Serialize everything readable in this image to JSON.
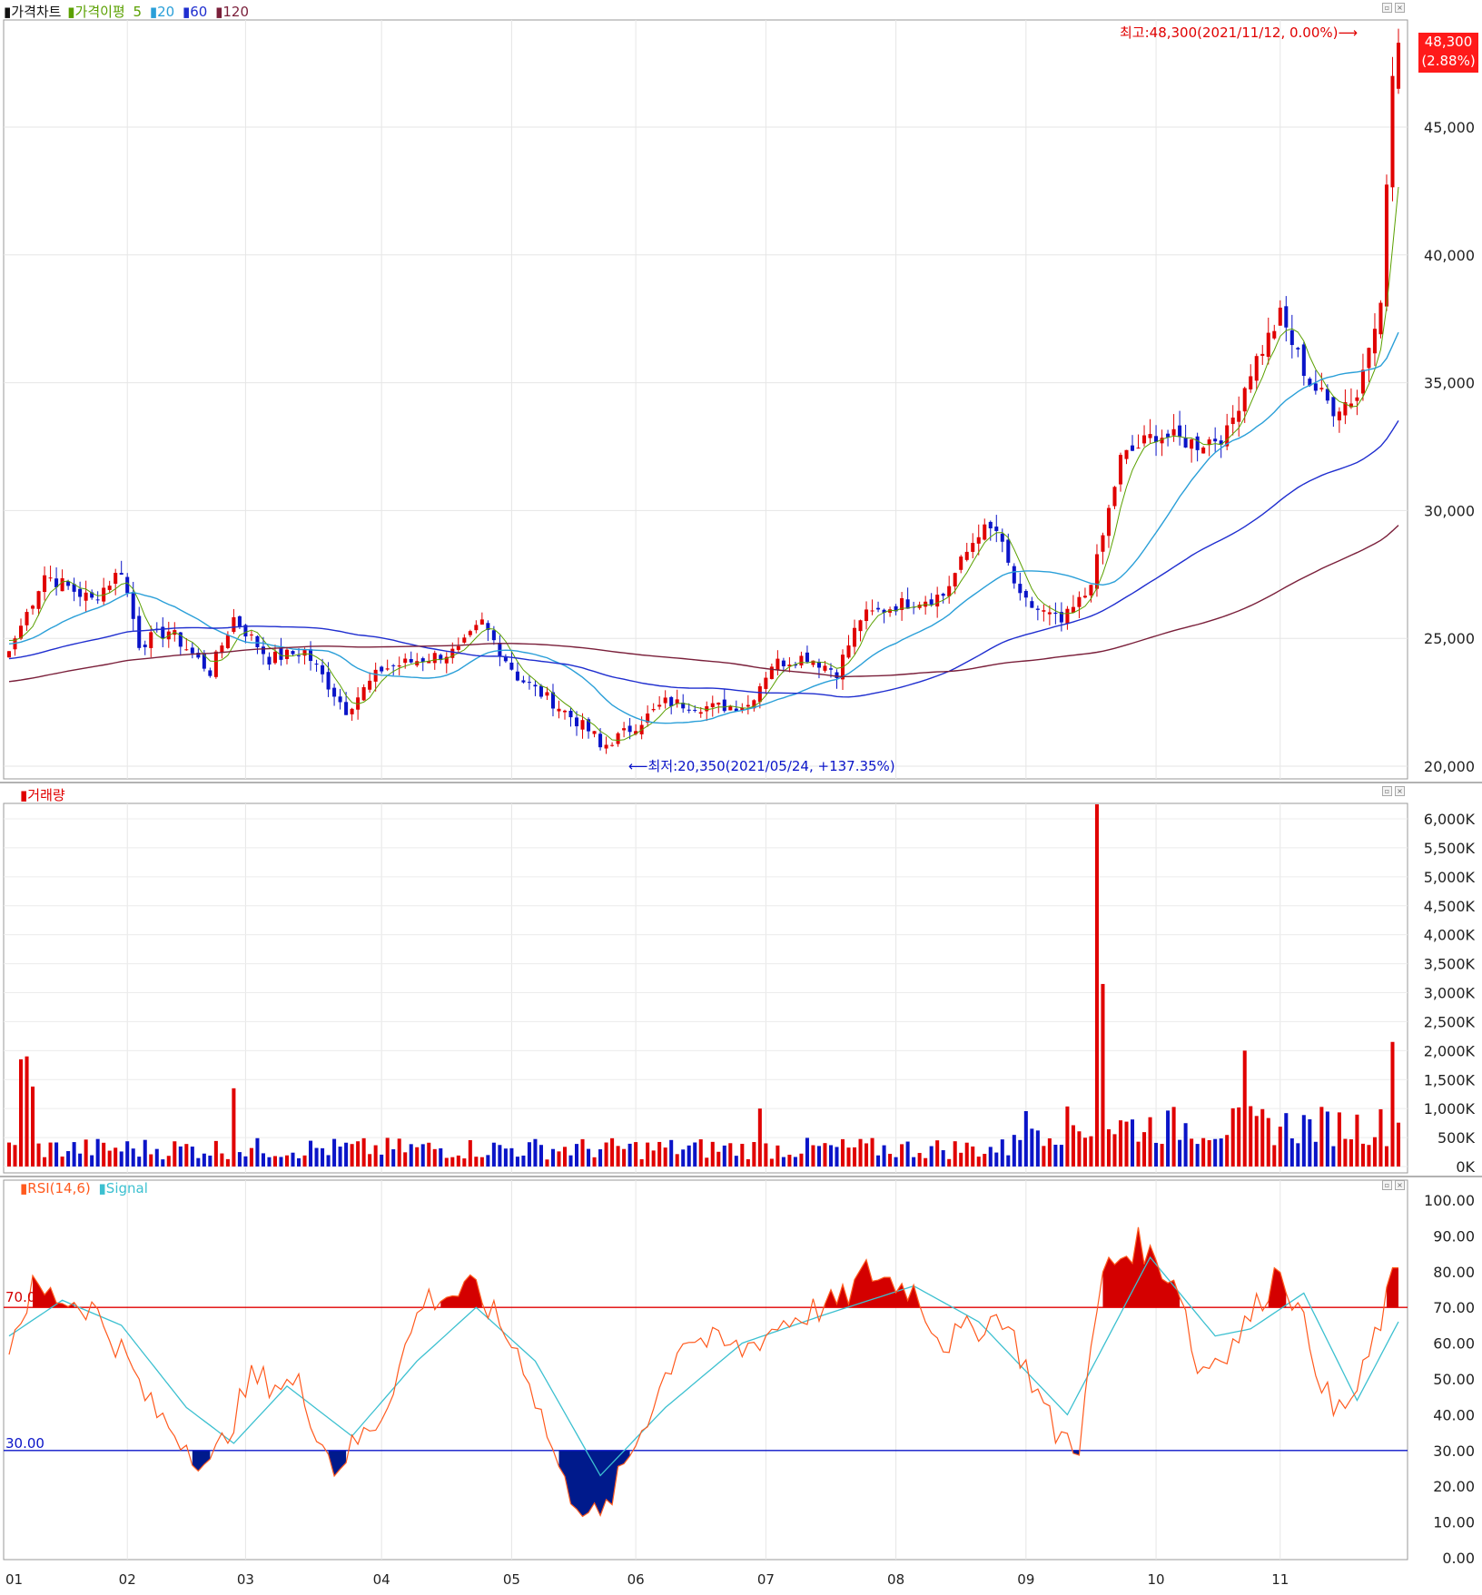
{
  "price_panel": {
    "title": "가격차트",
    "ma_label": "가격이평",
    "ma_periods": [
      "5",
      "20",
      "60",
      "120"
    ],
    "ma_colors": [
      "#5aa000",
      "#2a9fd8",
      "#1f2ecf",
      "#7a1f3a"
    ],
    "current_price_tag": "48,300",
    "current_change_tag": "(2.88%)",
    "high_annotation": "최고:48,300(2021/11/12, 0.00%)",
    "low_annotation": "최저:20,350(2021/05/24, +137.35%)"
  },
  "volume_panel": {
    "title": "거래량"
  },
  "rsi_panel": {
    "title": "RSI(14,6)",
    "signal_label": "Signal",
    "upper_line_label": "70.00",
    "lower_line_label": "30.00"
  },
  "colors": {
    "up": "#e00000",
    "down": "#0a14c8",
    "rsi": "#ff5a1e",
    "signal": "#3cc0d0",
    "rsi_hi_fill": "#d40000",
    "rsi_lo_fill": "#001a8c"
  },
  "chart_data": [
    {
      "type": "candlestick",
      "x_axis": "2021 daily",
      "month_labels": [
        "01",
        "02",
        "03",
        "04",
        "05",
        "06",
        "07",
        "08",
        "09",
        "10",
        "11"
      ],
      "ylim": [
        20000,
        50000
      ],
      "y_ticks": [
        "20,000",
        "25,000",
        "30,000",
        "35,000",
        "40,000",
        "45,000"
      ],
      "price_anchors": [
        [
          "2021-01-04",
          24500
        ],
        [
          "2021-01-12",
          27500
        ],
        [
          "2021-01-22",
          26500
        ],
        [
          "2021-01-29",
          27700
        ],
        [
          "2021-02-03",
          24800
        ],
        [
          "2021-02-10",
          25300
        ],
        [
          "2021-02-19",
          23700
        ],
        [
          "2021-02-25",
          25800
        ],
        [
          "2021-03-05",
          24200
        ],
        [
          "2021-03-15",
          24500
        ],
        [
          "2021-03-24",
          22200
        ],
        [
          "2021-04-01",
          23800
        ],
        [
          "2021-04-12",
          24200
        ],
        [
          "2021-04-20",
          24500
        ],
        [
          "2021-04-26",
          25600
        ],
        [
          "2021-05-04",
          23500
        ],
        [
          "2021-05-12",
          22500
        ],
        [
          "2021-05-21",
          21200
        ],
        [
          "2021-05-24",
          20700
        ],
        [
          "2021-06-01",
          21600
        ],
        [
          "2021-06-08",
          22500
        ],
        [
          "2021-06-18",
          22300
        ],
        [
          "2021-06-28",
          22400
        ],
        [
          "2021-07-02",
          24000
        ],
        [
          "2021-07-12",
          24300
        ],
        [
          "2021-07-19",
          23700
        ],
        [
          "2021-07-23",
          25800
        ],
        [
          "2021-08-02",
          26300
        ],
        [
          "2021-08-12",
          26700
        ],
        [
          "2021-08-20",
          29200
        ],
        [
          "2021-08-25",
          29200
        ],
        [
          "2021-08-31",
          26500
        ],
        [
          "2021-09-09",
          25600
        ],
        [
          "2021-09-15",
          26700
        ],
        [
          "2021-09-17",
          28000
        ],
        [
          "2021-09-23",
          32000
        ],
        [
          "2021-10-01",
          33000
        ],
        [
          "2021-10-12",
          32600
        ],
        [
          "2021-10-19",
          33000
        ],
        [
          "2021-10-25",
          35500
        ],
        [
          "2021-11-01",
          37600
        ],
        [
          "2021-11-08",
          35000
        ],
        [
          "2021-11-12",
          34000
        ],
        [
          "2021-11-18",
          34500
        ],
        [
          "2021-11-24",
          38500
        ],
        [
          "2021-11-26",
          47000
        ],
        [
          "2021-11-29",
          48300
        ]
      ],
      "high": 48300,
      "high_date": "2021/11/12",
      "low": 20350,
      "low_date": "2021/05/24"
    },
    {
      "type": "bar",
      "name": "거래량",
      "ylim": [
        0,
        6300
      ],
      "y_ticks": [
        "0K",
        "500K",
        "1,000K",
        "1,500K",
        "2,000K",
        "2,500K",
        "3,000K",
        "3,500K",
        "4,000K",
        "4,500K",
        "5,000K",
        "5,500K",
        "6,000K"
      ],
      "spikes": [
        [
          "2021-01-06",
          1850
        ],
        [
          "2021-01-07",
          1900
        ],
        [
          "2021-01-08",
          1380
        ],
        [
          "2021-02-25",
          1350
        ],
        [
          "2021-06-30",
          1000
        ],
        [
          "2021-09-17",
          6250
        ],
        [
          "2021-09-20",
          3150
        ],
        [
          "2021-10-22",
          2000
        ],
        [
          "2021-11-26",
          2150
        ]
      ]
    },
    {
      "type": "line",
      "name": "RSI(14,6)",
      "ylim": [
        0,
        100
      ],
      "y_ticks": [
        "0.00",
        "10.00",
        "20.00",
        "30.00",
        "40.00",
        "50.00",
        "60.00",
        "70.00",
        "80.00",
        "90.00",
        "100.00"
      ],
      "reference_lines": [
        70,
        30
      ],
      "rsi_anchors": [
        [
          "2021-01-04",
          60
        ],
        [
          "2021-01-10",
          75
        ],
        [
          "2021-01-22",
          70
        ],
        [
          "2021-01-31",
          58
        ],
        [
          "2021-02-06",
          42
        ],
        [
          "2021-02-15",
          32
        ],
        [
          "2021-02-20",
          25
        ],
        [
          "2021-03-02",
          50
        ],
        [
          "2021-03-14",
          48
        ],
        [
          "2021-03-22",
          25
        ],
        [
          "2021-04-01",
          40
        ],
        [
          "2021-04-12",
          72
        ],
        [
          "2021-04-25",
          75
        ],
        [
          "2021-05-05",
          55
        ],
        [
          "2021-05-15",
          20
        ],
        [
          "2021-05-24",
          10
        ],
        [
          "2021-06-03",
          40
        ],
        [
          "2021-06-12",
          62
        ],
        [
          "2021-06-25",
          58
        ],
        [
          "2021-07-06",
          66
        ],
        [
          "2021-07-20",
          72
        ],
        [
          "2021-07-26",
          80
        ],
        [
          "2021-08-05",
          75
        ],
        [
          "2021-08-12",
          60
        ],
        [
          "2021-08-26",
          68
        ],
        [
          "2021-09-08",
          35
        ],
        [
          "2021-09-14",
          32
        ],
        [
          "2021-09-20",
          80
        ],
        [
          "2021-09-28",
          88
        ],
        [
          "2021-10-07",
          76
        ],
        [
          "2021-10-12",
          52
        ],
        [
          "2021-10-20",
          60
        ],
        [
          "2021-10-26",
          70
        ],
        [
          "2021-11-01",
          82
        ],
        [
          "2021-11-08",
          60
        ],
        [
          "2021-11-12",
          40
        ],
        [
          "2021-11-18",
          46
        ],
        [
          "2021-11-29",
          82
        ]
      ],
      "signal_anchors": [
        [
          "2021-01-04",
          62
        ],
        [
          "2021-01-15",
          72
        ],
        [
          "2021-01-31",
          65
        ],
        [
          "2021-02-15",
          42
        ],
        [
          "2021-02-25",
          32
        ],
        [
          "2021-03-10",
          48
        ],
        [
          "2021-03-25",
          34
        ],
        [
          "2021-04-10",
          55
        ],
        [
          "2021-04-25",
          70
        ],
        [
          "2021-05-08",
          55
        ],
        [
          "2021-05-24",
          23
        ],
        [
          "2021-06-08",
          42
        ],
        [
          "2021-06-25",
          60
        ],
        [
          "2021-07-15",
          68
        ],
        [
          "2021-08-05",
          76
        ],
        [
          "2021-08-20",
          66
        ],
        [
          "2021-09-10",
          40
        ],
        [
          "2021-09-30",
          84
        ],
        [
          "2021-10-15",
          62
        ],
        [
          "2021-10-25",
          64
        ],
        [
          "2021-11-05",
          74
        ],
        [
          "2021-11-18",
          44
        ],
        [
          "2021-11-29",
          66
        ]
      ]
    }
  ]
}
